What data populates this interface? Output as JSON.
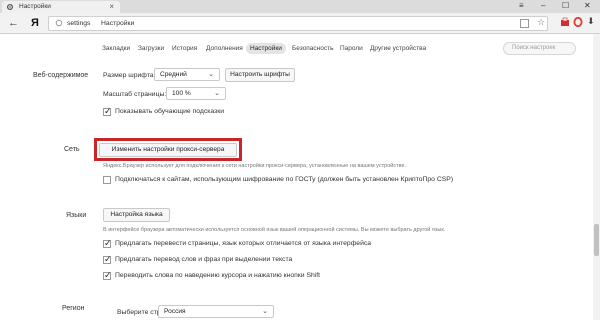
{
  "window": {
    "tab_title": "Настройки",
    "tab_close": "×",
    "controls": {
      "menu": "≡",
      "minimize": "–",
      "maximize": "☐",
      "close": "✕"
    }
  },
  "toolbar": {
    "back_glyph": "←",
    "logo": "Я",
    "url": "settings",
    "page_title": "Настройки",
    "star_glyph": "☆",
    "downloads_glyph": "⬇"
  },
  "nav": {
    "items": [
      {
        "label": "Закладки",
        "active": false
      },
      {
        "label": "Загрузки",
        "active": false
      },
      {
        "label": "История",
        "active": false
      },
      {
        "label": "Дополнения",
        "active": false
      },
      {
        "label": "Настройки",
        "active": true
      },
      {
        "label": "Безопасность",
        "active": false
      },
      {
        "label": "Пароли",
        "active": false
      },
      {
        "label": "Другие устройства",
        "active": false
      }
    ],
    "search_placeholder": "Поиск настроек"
  },
  "web_content": {
    "label": "Веб-содержимое",
    "font_size_label": "Размер шрифта:",
    "font_size_value": "Средний",
    "configure_fonts_button": "Настроить шрифты",
    "page_zoom_label": "Масштаб страницы:",
    "page_zoom_value": "100 %",
    "show_tips_label": "Показывать обучающие подсказки",
    "show_tips_checked": true
  },
  "network": {
    "label": "Сеть",
    "proxy_button": "Изменить настройки прокси-сервера",
    "proxy_note": "Яндекс.Браузер использует для подключения к сети настройки прокси-сервера, установленные на вашем устройстве.",
    "gost_label": "Подключаться к сайтам, использующим шифрование по ГОСТу (должен быть установлен КриптоПро CSP)",
    "gost_checked": false
  },
  "languages": {
    "label": "Языки",
    "settings_button": "Настройка языка",
    "note": "В интерфейсе браузера автоматически используется основной язык вашей операционной системы. Вы можете выбрать другой язык.",
    "options": [
      {
        "label": "Предлагать перевести страницы, язык которых отличается от языка интерфейса",
        "checked": true
      },
      {
        "label": "Предлагать перевод слов и фраз при выделении текста",
        "checked": true
      },
      {
        "label": "Переводить слова по наведению курсора и нажатию кнопки Shift",
        "checked": true
      }
    ]
  },
  "region": {
    "label": "Регион",
    "choose_country_label": "Выберите страну:",
    "country_value": "Россия"
  },
  "colors": {
    "highlight": "#c62828",
    "yandex_red": "#e53935"
  }
}
